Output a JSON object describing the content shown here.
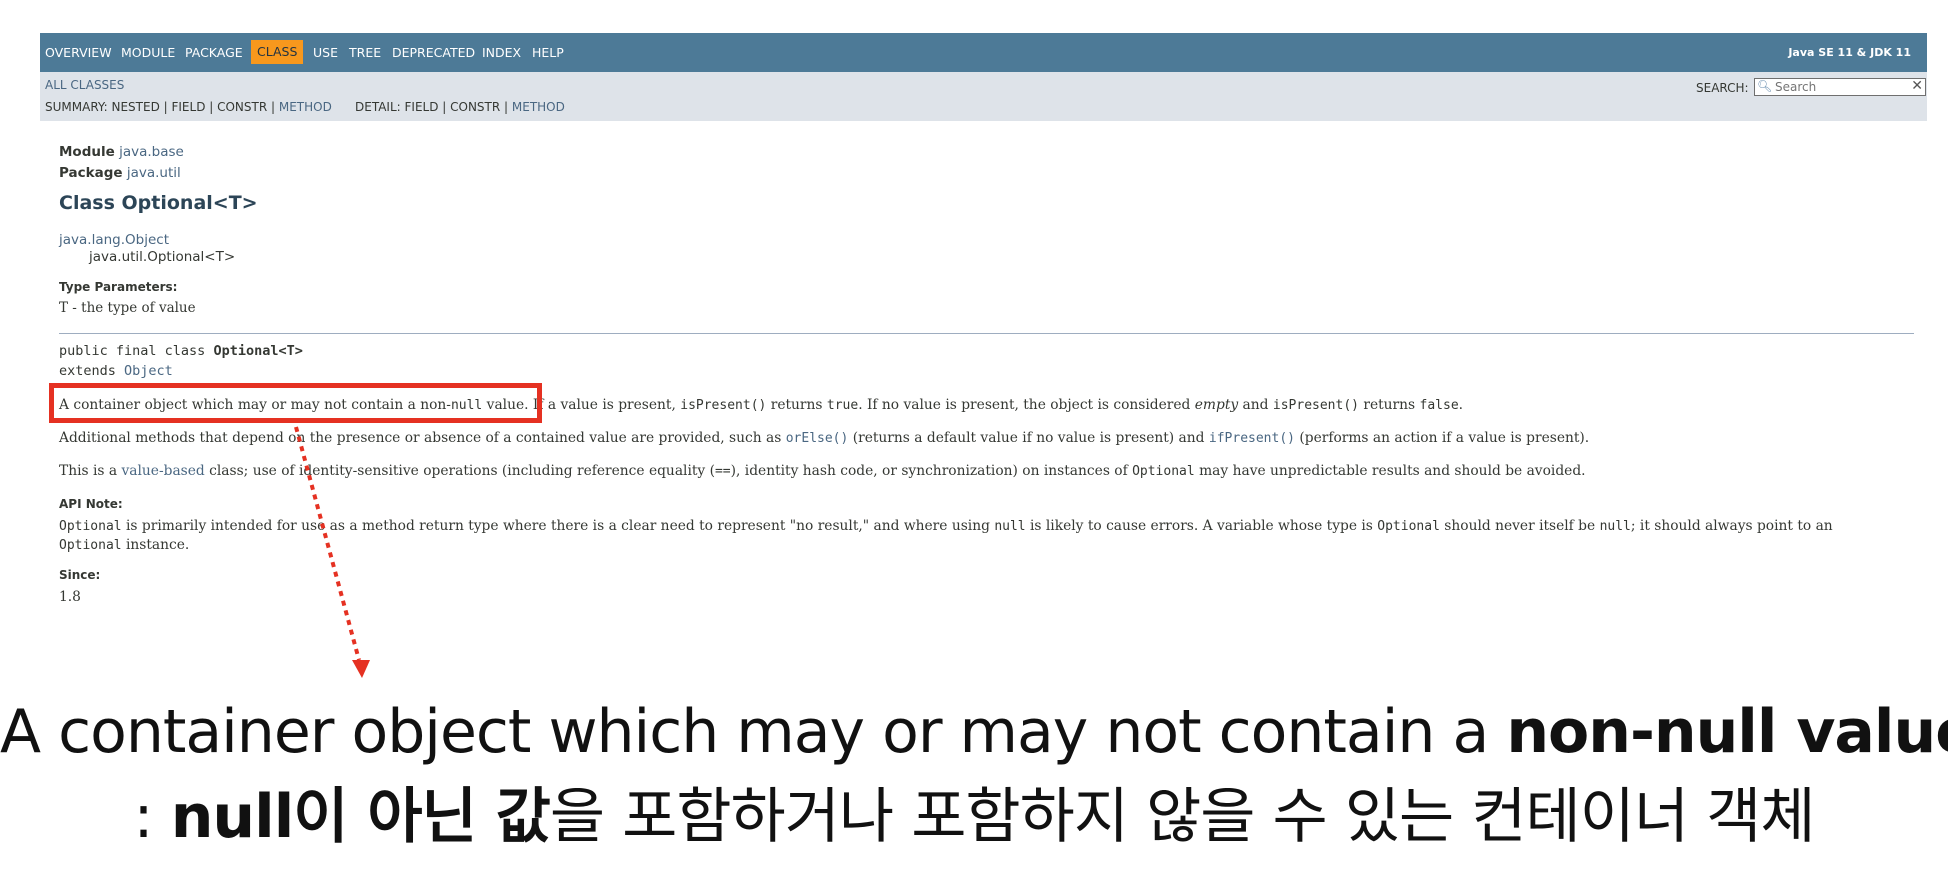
{
  "topnav": {
    "items": [
      "OVERVIEW",
      "MODULE",
      "PACKAGE",
      "CLASS",
      "USE",
      "TREE",
      "DEPRECATED",
      "INDEX",
      "HELP"
    ],
    "active_item": "CLASS",
    "about_language": "Java SE 11 & JDK 11"
  },
  "subnav": {
    "all_classes": "ALL CLASSES",
    "summary_prefix": "SUMMARY: NESTED | FIELD | CONSTR | ",
    "summary_method": "METHOD",
    "detail_prefix": "DETAIL: FIELD | CONSTR | ",
    "detail_method": "METHOD",
    "search_label": "SEARCH:",
    "search_placeholder": "Search",
    "search_icon": "magnifier-icon",
    "reset_icon": "close-icon"
  },
  "header": {
    "module_label": "Module",
    "module_link": "java.base",
    "package_label": "Package",
    "package_link": "java.util",
    "class_title": "Class Optional<T>"
  },
  "inheritance": {
    "parent": "java.lang.Object",
    "child": "java.util.Optional<T>"
  },
  "type_parameters": {
    "label": "Type Parameters:",
    "value": "T - the type of value"
  },
  "signature": {
    "line1_prefix": "public final class ",
    "line1_class": "Optional<T>",
    "line2_prefix": "extends ",
    "line2_link": "Object"
  },
  "description": {
    "p1_a": "A container object which may or may not contain a non-",
    "p1_null": "null",
    "p1_b": " value. If a value is present, ",
    "p1_isPresent": "isPresent()",
    "p1_c": " returns ",
    "p1_true": "true",
    "p1_d": ". If no value is present, the object is considered ",
    "p1_empty": "empty",
    "p1_e": " and ",
    "p1_isPresent2": "isPresent()",
    "p1_f": " returns ",
    "p1_false": "false",
    "p1_g": ".",
    "p2_a": "Additional methods that depend on the presence or absence of a contained value are provided, such as ",
    "p2_orElse": "orElse()",
    "p2_b": " (returns a default value if no value is present) and ",
    "p2_ifPresent": "ifPresent()",
    "p2_c": " (performs an action if a value is present).",
    "p3_a": "This is a ",
    "p3_link": "value-based",
    "p3_b": " class; use of identity-sensitive operations (including reference equality (",
    "p3_eq": "==",
    "p3_c": "), identity hash code, or synchronization) on instances of ",
    "p3_optional": "Optional",
    "p3_d": " may have unpredictable results and should be avoided."
  },
  "api_note": {
    "label": "API Note:",
    "l1_optional": "Optional",
    "l1_a": " is primarily intended for use as a method return type where there is a clear need to represent \"no result,\" and where using ",
    "l1_null": "null",
    "l1_b": " is likely to cause errors. A variable whose type is ",
    "l1_optional2": "Optional",
    "l1_c": " should never itself be ",
    "l1_null2": "null",
    "l1_d": "; it should always point to an",
    "l2_optional": "Optional",
    "l2_a": " instance."
  },
  "since": {
    "label": "Since:",
    "value": "1.8"
  },
  "caption": {
    "line1_a": "A container object which may or may not contain a ",
    "line1_bold": "non-null value",
    "line2_a": ": ",
    "line2_bold": "null이 아닌 값",
    "line2_b": "을 포함하거나 포함하지 않을 수 있는 컨테이너 객체"
  },
  "annotation_color": "#e53122"
}
